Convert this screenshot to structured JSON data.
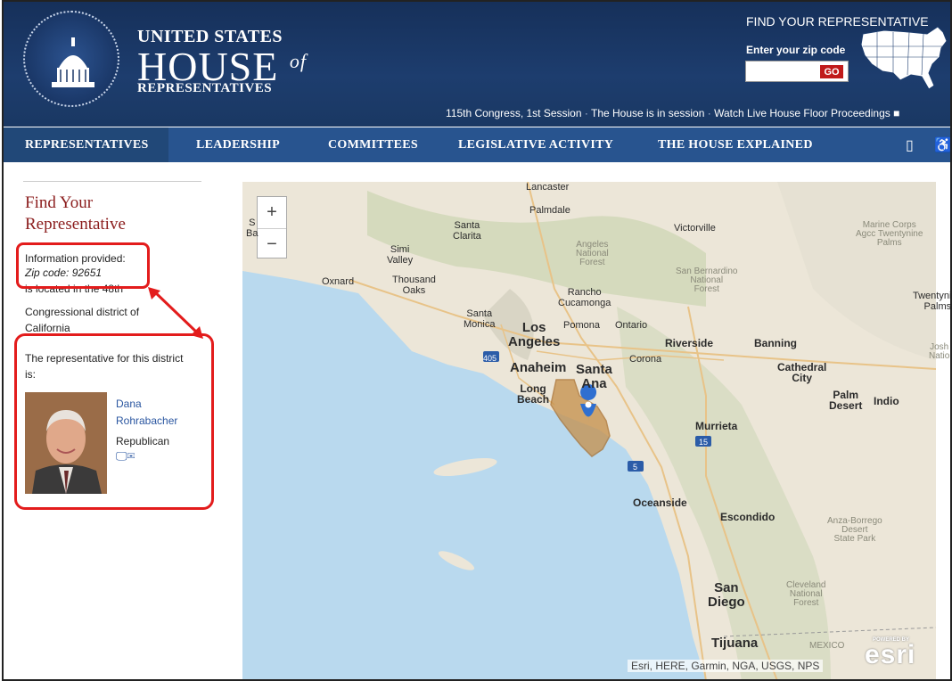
{
  "header": {
    "brand_line1": "UNITED STATES",
    "brand_line2": "HOUSE",
    "brand_of": "of",
    "brand_line3": "REPRESENTATIVES",
    "find_title": "FIND YOUR REPRESENTATIVE",
    "zip_label": "Enter your zip code",
    "zip_value": "",
    "go_label": "GO",
    "session_congress": "115th Congress, 1st Session",
    "session_status": "The House is in session",
    "session_watch": "Watch Live House Floor Proceedings",
    "separator": "·"
  },
  "nav": {
    "items": [
      {
        "label": "REPRESENTATIVES"
      },
      {
        "label": "LEADERSHIP"
      },
      {
        "label": "COMMITTEES"
      },
      {
        "label": "LEGISLATIVE ACTIVITY"
      },
      {
        "label": "THE HOUSE EXPLAINED"
      }
    ],
    "mobile_icon": "mobile-icon",
    "accessibility_icon": "accessibility-icon"
  },
  "sidebar": {
    "title": "Find Your Representative",
    "info_label": "Information provided:",
    "zip_text": "Zip code: 92651",
    "located_line1": "is located in the 48th",
    "located_line2": "Congressional district of",
    "located_line3": "California",
    "rep_intro_line1": "The representative for this district",
    "rep_intro_line2": "is:",
    "rep_first": "Dana",
    "rep_last": "Rohrabacher",
    "rep_party": "Republican"
  },
  "map": {
    "zoom_in": "+",
    "zoom_out": "−",
    "attribution": "Esri, HERE, Garmin, NGA, USGS, NPS",
    "esri_logo": "esri",
    "esri_powered": "POWERED BY",
    "labels": {
      "lancaster": "Lancaster",
      "palmdale": "Palmdale",
      "santa_clarita": "Santa\nClarita",
      "victorville": "Victorville",
      "simi_valley": "Simi\nValley",
      "oxnard": "Oxnard",
      "thousand_oaks": "Thousand\nOaks",
      "rancho": "Rancho\nCucamonga",
      "santa_monica": "Santa\nMonica",
      "los_angeles": "Los\nAngeles",
      "pomona": "Pomona",
      "ontario": "Ontario",
      "riverside": "Riverside",
      "banning": "Banning",
      "anaheim": "Anaheim",
      "santa_ana": "Santa\nAna",
      "corona": "Corona",
      "long_beach": "Long\nBeach",
      "cathedral_city": "Cathedral\nCity",
      "palm_desert": "Palm\nDesert",
      "indio": "Indio",
      "murrieta": "Murrieta",
      "oceanside": "Oceanside",
      "escondido": "Escondido",
      "san_diego": "San\nDiego",
      "tijuana": "Tijuana",
      "mexico": "MEXICO",
      "twentynine_palms": "Twentynine\nPalms",
      "sb_forest": "San Bernardino\nNational\nForest",
      "angeles_forest": "Angeles\nNational\nForest",
      "marine_corps": "Marine Corps\nAgcc Twentynine\nPalms",
      "anza_borrego": "Anza-Borrego\nDesert\nState Park",
      "cleveland": "Cleveland\nNational\nForest",
      "joshua": "Josh\nNatio",
      "hwy_405": "405",
      "hwy_15": "15",
      "hwy_5": "5",
      "sa_fragment": "S\nBa"
    }
  }
}
